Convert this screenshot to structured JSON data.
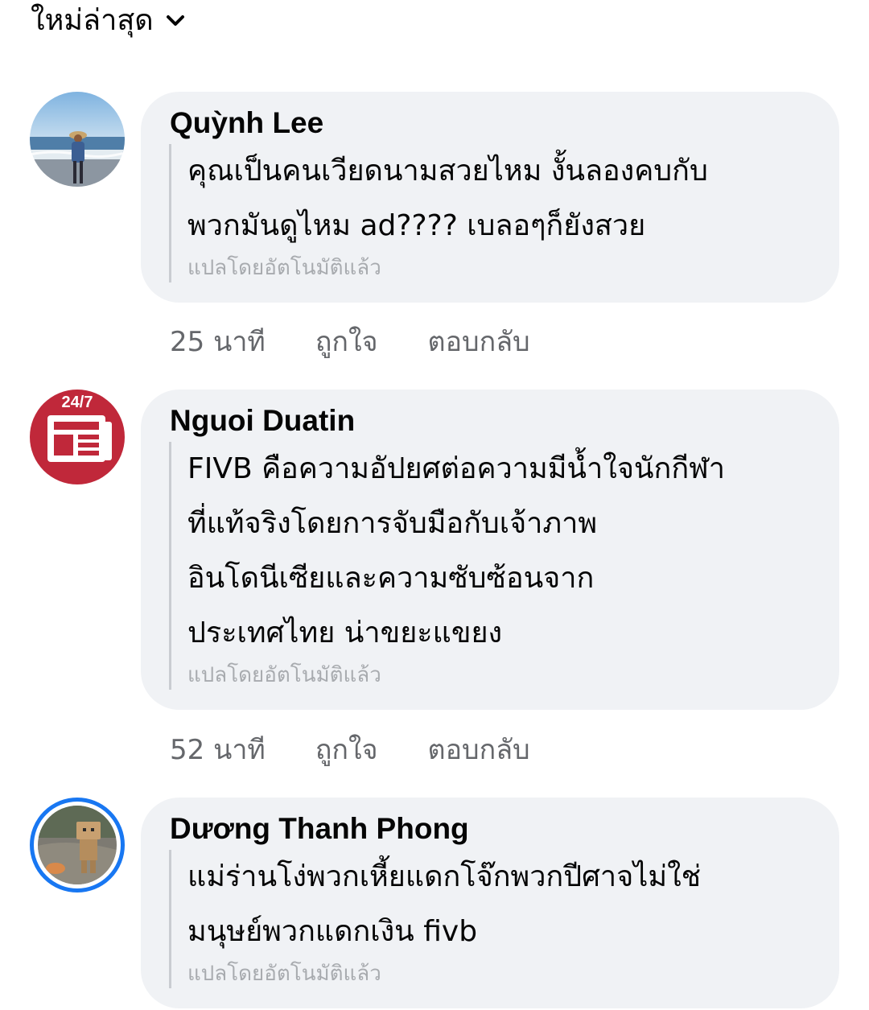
{
  "sort": {
    "label": "ใหม่ล่าสุด",
    "icon": "chevron-down-icon"
  },
  "comments": [
    {
      "author": "Quỳnh Lee",
      "text": "คุณเป็นคนเวียดนามสวยไหม งั้นลองคบกับ\nพวกมันดูไหม ad???? เบลอๆก็ยังสวย",
      "translated_note": "แปลโดยอัตโนมัติแล้ว",
      "time": "25 นาที",
      "like_label": "ถูกใจ",
      "reply_label": "ตอบกลับ"
    },
    {
      "author": "Nguoi Duatin",
      "avatar_badge": "24/7",
      "text": "FIVB คือความอัปยศต่อความมีน้ำใจนักกีฬา\nที่แท้จริงโดยการจับมือกับเจ้าภาพ\nอินโดนีเซียและความซับซ้อนจาก\nประเทศไทย น่าขยะแขยง",
      "translated_note": "แปลโดยอัตโนมัติแล้ว",
      "time": "52 นาที",
      "like_label": "ถูกใจ",
      "reply_label": "ตอบกลับ"
    },
    {
      "author": "Dương Thanh Phong",
      "text": "แม่ร่านโง่พวกเหี้ยแดกโจ๊กพวกปีศาจไม่ใช่\nมนุษย์พวกแดกเงิน fivb",
      "translated_note": "แปลโดยอัตโนมัติแล้ว"
    }
  ],
  "colors": {
    "bubble": "#f0f2f5",
    "meta_text": "#65676b",
    "translated_text": "#a8abaf",
    "story_ring": "#1877f2",
    "news_avatar": "#c0283a"
  }
}
